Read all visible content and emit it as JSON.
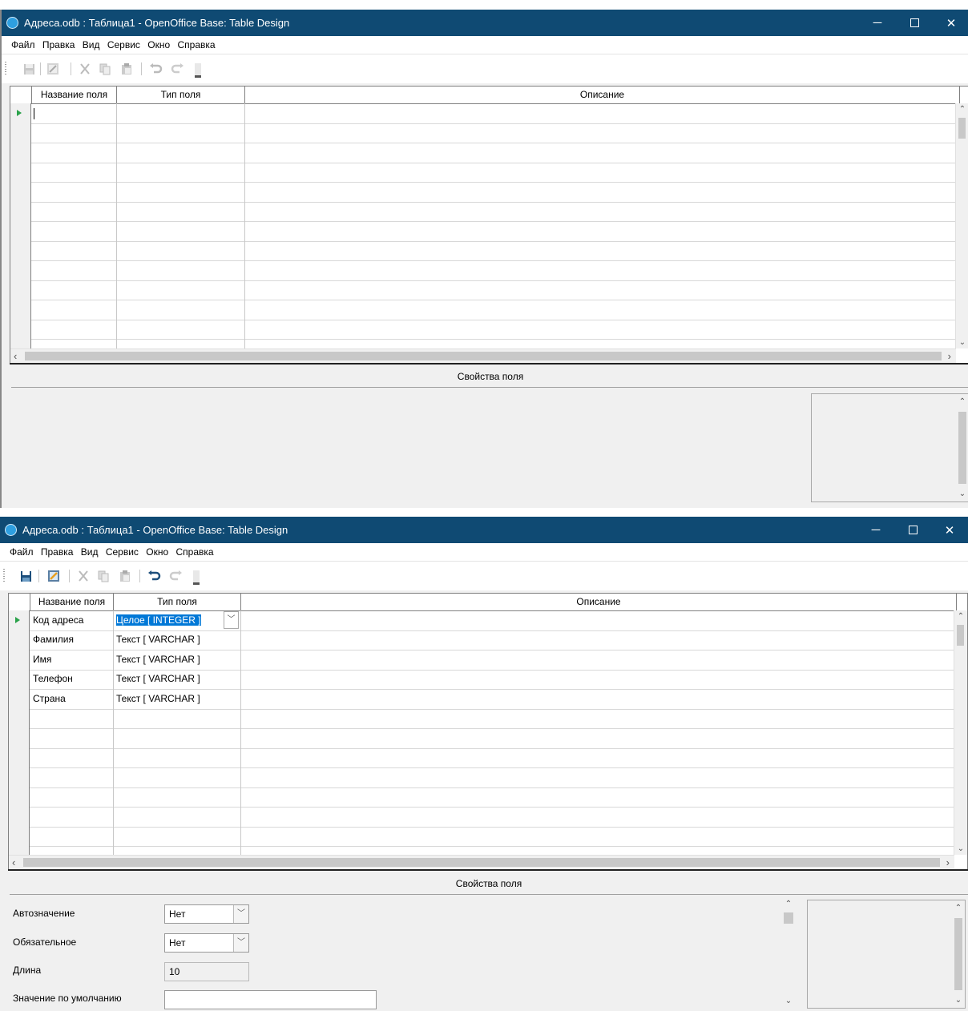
{
  "window1": {
    "title": "Адреса.odb : Таблица1 - OpenOffice Base: Table Design",
    "menu": [
      "Файл",
      "Правка",
      "Вид",
      "Сервис",
      "Окно",
      "Справка"
    ],
    "columns": [
      "Название поля",
      "Тип поля",
      "Описание"
    ],
    "props_title": "Свойства поля"
  },
  "window2": {
    "title": "Адреса.odb : Таблица1 - OpenOffice Base: Table Design",
    "menu": [
      "Файл",
      "Правка",
      "Вид",
      "Сервис",
      "Окно",
      "Справка"
    ],
    "columns": [
      "Название поля",
      "Тип поля",
      "Описание"
    ],
    "rows": [
      {
        "name": "Код адреса",
        "type": "Целое [ INTEGER ]"
      },
      {
        "name": "Фамилия",
        "type": "Текст [ VARCHAR ]"
      },
      {
        "name": "Имя",
        "type": "Текст [ VARCHAR ]"
      },
      {
        "name": "Телефон",
        "type": "Текст [ VARCHAR ]"
      },
      {
        "name": "Страна",
        "type": "Текст [ VARCHAR ]"
      }
    ],
    "props_title": "Свойства поля",
    "props": {
      "autovalue_label": "Автозначение",
      "autovalue_value": "Нет",
      "required_label": "Обязательное",
      "required_value": "Нет",
      "length_label": "Длина",
      "length_value": "10",
      "default_label": "Значение по умолчанию",
      "default_value": ""
    }
  },
  "window_controls": {
    "minimize": "─",
    "close": "✕"
  },
  "scroll_glyphs": {
    "up": "⌃",
    "down": "⌄",
    "left": "‹",
    "right": "›",
    "dropdown": "﹀"
  },
  "toolbar_icons": [
    "save-icon",
    "edit-icon",
    "cut-icon",
    "copy-icon",
    "paste-icon",
    "undo-icon",
    "redo-icon"
  ],
  "colors": {
    "titlebar": "#0f4a73",
    "selection": "#0078d7",
    "row_marker": "#2aa24a"
  }
}
